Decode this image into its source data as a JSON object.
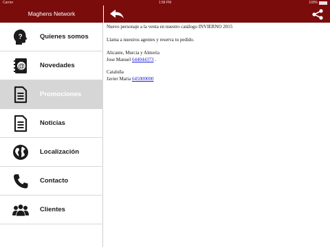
{
  "status_bar": {
    "carrier": "Carrier",
    "time": "1:58 PM",
    "battery": "100%"
  },
  "sidebar": {
    "title": "Maghens Network",
    "items": [
      {
        "label": "Quienes somos",
        "icon": "question-head-icon",
        "selected": false
      },
      {
        "label": "Novedades",
        "icon": "address-book-icon",
        "selected": false
      },
      {
        "label": "Promociones",
        "icon": "document-icon",
        "selected": true
      },
      {
        "label": "Noticias",
        "icon": "document-icon",
        "selected": false
      },
      {
        "label": "Localización",
        "icon": "globe-icon",
        "selected": false
      },
      {
        "label": "Contacto",
        "icon": "phone-icon",
        "selected": false
      },
      {
        "label": "Clientes",
        "icon": "people-icon",
        "selected": false
      }
    ]
  },
  "header": {
    "back_icon": "back-arrow-icon",
    "share_icon": "share-icon"
  },
  "content": {
    "line1": "Nuevo personaje a la venta en nuestro catálogo INVIERNO 2015",
    "line2": "Llama a nuestros agentes y reserva tu pedido.",
    "line3": "Alicante, Murcia y Almería",
    "contact1_name": "Jose Manuel",
    "contact1_phone": "644044373",
    "contact1_suffix": ".",
    "line5": "Cataluña",
    "contact2_name": "Javier Maria",
    "contact2_phone": "645000000"
  },
  "colors": {
    "brand": "#7a0c0c",
    "selected_bg": "#d6d6d6",
    "link": "#1a1ad6"
  }
}
